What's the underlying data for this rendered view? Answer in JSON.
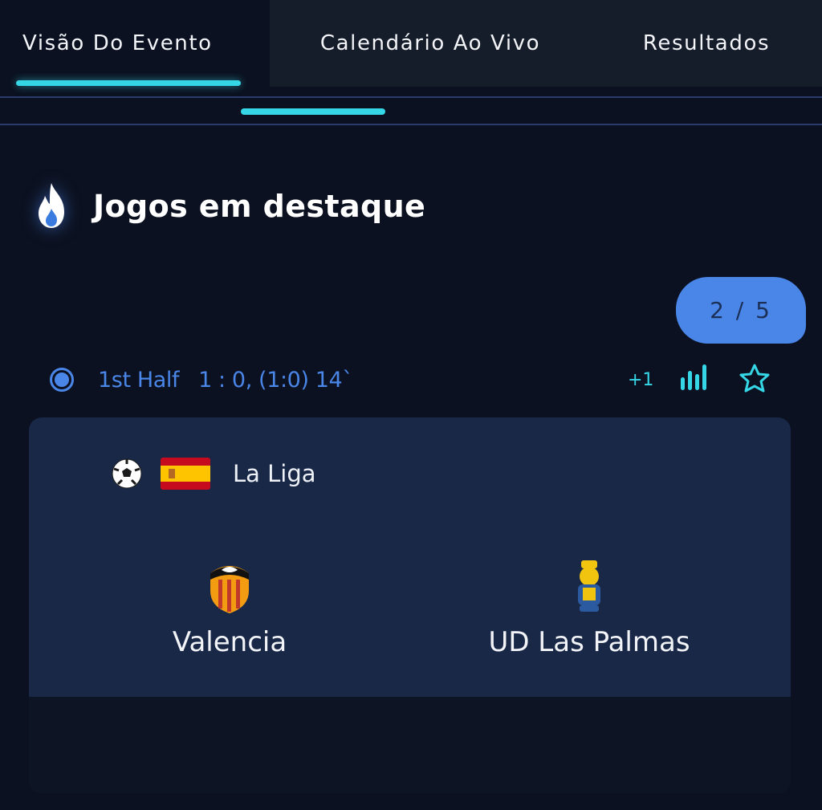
{
  "tabs": [
    {
      "label": "Visão Do Evento",
      "active": true
    },
    {
      "label": "Calendário Ao Vivo",
      "active": false
    },
    {
      "label": "Resultados",
      "active": false
    }
  ],
  "section": {
    "title": "Jogos em destaque",
    "icon": "flame-icon"
  },
  "pager": {
    "text": "2 / 5",
    "current": 2,
    "total": 5
  },
  "match": {
    "status": "1st Half",
    "score": "1 : 0, (1:0) 14`",
    "more_markets": "+1",
    "league": {
      "name": "La Liga",
      "sport_icon": "soccer-ball-icon",
      "flag_icon": "spain-flag-icon"
    },
    "home": {
      "name": "Valencia",
      "crest_icon": "valencia-crest-icon"
    },
    "away": {
      "name": "UD Las Palmas",
      "crest_icon": "las-palmas-crest-icon"
    }
  },
  "colors": {
    "background": "#0b1120",
    "accent_cyan": "#35d7e6",
    "accent_blue": "#4a86e8",
    "card": "#1a2848",
    "tab_inactive": "#161d2a"
  }
}
